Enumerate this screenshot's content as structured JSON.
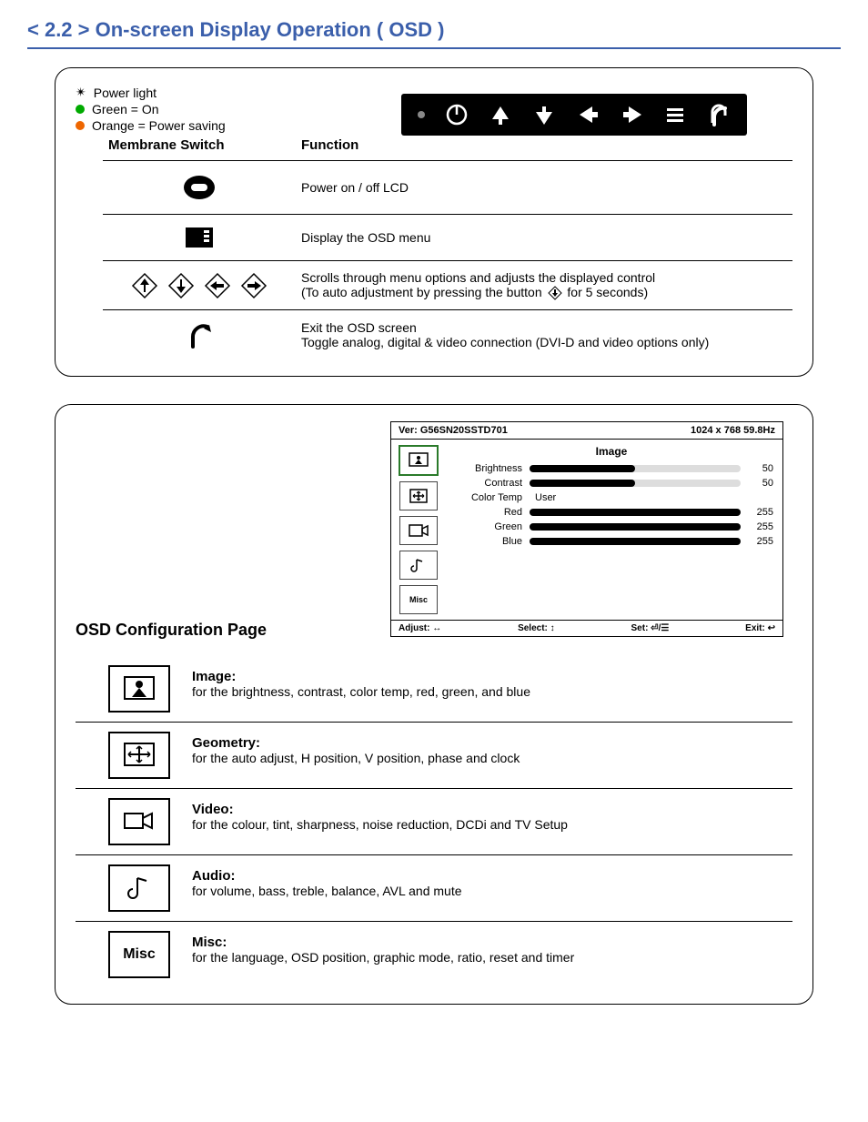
{
  "title": "< 2.2 > On-screen Display Operation ( OSD )",
  "legend": {
    "power_light": "Power light",
    "green": "Green = On",
    "orange": "Orange = Power saving"
  },
  "membrane_table": {
    "col_switch": "Membrane Switch",
    "col_function": "Function",
    "rows": [
      {
        "fn": "Power on / off LCD"
      },
      {
        "fn": "Display the OSD menu"
      },
      {
        "fn_a": "Scrolls through menu options and adjusts the displayed control",
        "fn_b_pre": "(To auto adjustment by pressing the button ",
        "fn_b_post": " for 5 seconds)"
      },
      {
        "fn_a": "Exit the OSD screen",
        "fn_b": "Toggle analog, digital & video connection (DVI-D and video options only)"
      }
    ]
  },
  "osd": {
    "version_label": "Ver: G56SN20SSTD701",
    "mode": "1024 x 768  59.8Hz",
    "tab_misc_label": "Misc",
    "page_title": "Image",
    "rows": {
      "brightness": {
        "label": "Brightness",
        "value": 50,
        "max": 100
      },
      "contrast": {
        "label": "Contrast",
        "value": 50,
        "max": 100
      },
      "colortemp": {
        "label": "Color Temp",
        "value": "User"
      },
      "red": {
        "label": "Red",
        "value": 255,
        "max": 255
      },
      "green": {
        "label": "Green",
        "value": 255,
        "max": 255
      },
      "blue": {
        "label": "Blue",
        "value": 255,
        "max": 255
      }
    },
    "footer": {
      "adjust": "Adjust: ↔",
      "select": "Select: ↕",
      "set": "Set: ⏎/☰",
      "exit": "Exit: ↩"
    }
  },
  "osd_config_title": "OSD Configuration Page",
  "config": [
    {
      "name": "Image:",
      "desc": "for the brightness, contrast, color temp, red, green, and blue"
    },
    {
      "name": "Geometry:",
      "desc": "for the auto adjust, H position, V position, phase and clock"
    },
    {
      "name": "Video:",
      "desc": "for the colour, tint, sharpness, noise reduction, DCDi and TV Setup"
    },
    {
      "name": "Audio:",
      "desc": "for volume, bass, treble, balance, AVL and mute"
    },
    {
      "name": "Misc:",
      "desc": "for the language, OSD position, graphic mode, ratio, reset and timer"
    }
  ],
  "config_misc_label": "Misc"
}
